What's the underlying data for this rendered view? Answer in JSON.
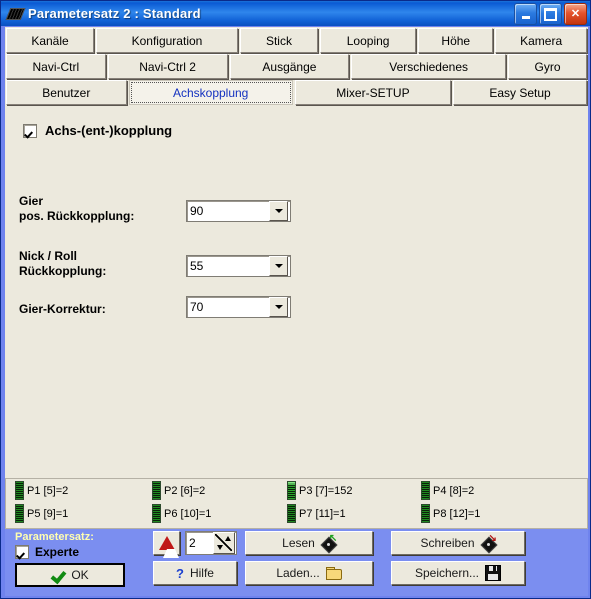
{
  "window": {
    "title": "Parametersatz 2 : Standard",
    "icon": "package-icon",
    "controls": {
      "minimize": "_",
      "maximize": "□",
      "close": "✕"
    }
  },
  "tabs": {
    "row1": [
      {
        "label": "Kanäle",
        "active": false
      },
      {
        "label": "Konfiguration",
        "active": false
      },
      {
        "label": "Stick",
        "active": false
      },
      {
        "label": "Looping",
        "active": false
      },
      {
        "label": "Höhe",
        "active": false
      },
      {
        "label": "Kamera",
        "active": false
      }
    ],
    "row2": [
      {
        "label": "Navi-Ctrl",
        "active": false
      },
      {
        "label": "Navi-Ctrl 2",
        "active": false
      },
      {
        "label": "Ausgänge",
        "active": false
      },
      {
        "label": "Verschiedenes",
        "active": false
      },
      {
        "label": "Gyro",
        "active": false
      }
    ],
    "row3": [
      {
        "label": "Benutzer",
        "active": false
      },
      {
        "label": "Achskopplung",
        "active": true
      },
      {
        "label": "Mixer-SETUP",
        "active": false
      },
      {
        "label": "Easy Setup",
        "active": false
      }
    ]
  },
  "main": {
    "enable_checkbox": {
      "label": "Achs-(ent-)kopplung",
      "checked": true
    },
    "fields": [
      {
        "label": "Gier\npos. Rückkopplung:",
        "value": "90"
      },
      {
        "label": "Nick / Roll\nRückkopplung:",
        "value": "55"
      },
      {
        "label": "Gier-Korrektur:",
        "value": "70"
      }
    ]
  },
  "status_panel": {
    "row1": [
      {
        "text": "P1 [5]=2",
        "hot": false
      },
      {
        "text": "P2 [6]=2",
        "hot": false
      },
      {
        "text": "P3 [7]=152",
        "hot": true
      },
      {
        "text": "P4 [8]=2",
        "hot": false
      }
    ],
    "row2": [
      {
        "text": "P5 [9]=1",
        "hot": false
      },
      {
        "text": "P6 [10]=1",
        "hot": false
      },
      {
        "text": "P7 [11]=1",
        "hot": false
      },
      {
        "text": "P8 [12]=1",
        "hot": false
      }
    ]
  },
  "bottom": {
    "group_title": "Parametersatz:",
    "experte_label": "Experte",
    "experte_checked": true,
    "ok_label": "OK",
    "warn_icon": "warning-triangle-icon",
    "parameterset_value": "2",
    "hilfe_label": "Hilfe",
    "lesen_label": "Lesen",
    "laden_label": "Laden...",
    "schreiben_label": "Schreiben",
    "speichern_label": "Speichern..."
  },
  "colors": {
    "titlebar_blue": "#0a5ad4",
    "panel_beige": "#ece9dd",
    "bottom_blue": "#7b8ef0",
    "active_tab_text": "#1331c0",
    "group_title": "#ffffb0",
    "led_green": "#1f8a1f"
  }
}
